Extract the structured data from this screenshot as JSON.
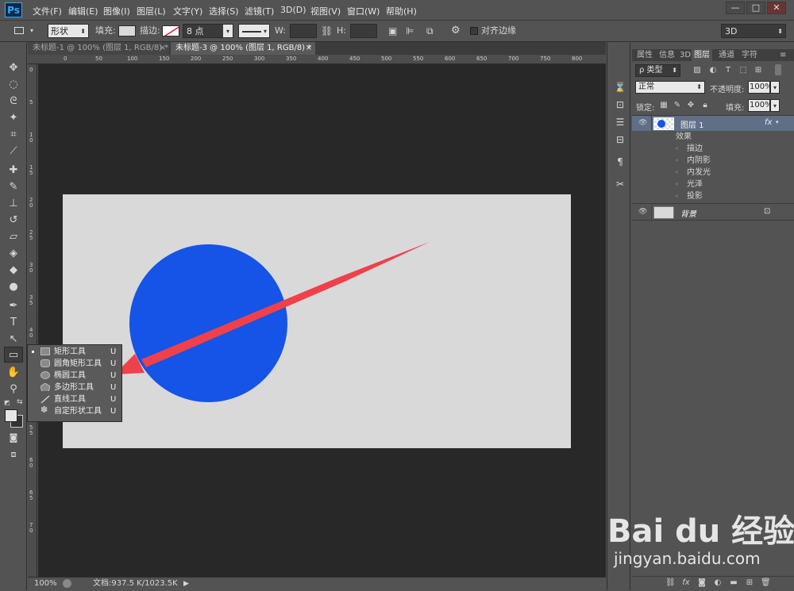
{
  "app": {
    "logo": "Ps"
  },
  "menu": [
    "文件(F)",
    "编辑(E)",
    "图像(I)",
    "图层(L)",
    "文字(Y)",
    "选择(S)",
    "滤镜(T)",
    "3D(D)",
    "视图(V)",
    "窗口(W)",
    "帮助(H)"
  ],
  "window_controls": {
    "minimize": "—",
    "restore": "□",
    "close": "✕"
  },
  "options": {
    "mode": "形状",
    "fill_label": "填充:",
    "stroke_label": "描边:",
    "stroke_size": "8 点",
    "w_label": "W:",
    "h_label": "H:",
    "align_edges": "对齐边缘",
    "workspace": "3D"
  },
  "tabs": [
    {
      "label": "未标题-1 @ 100% (图层 1, RGB/8) *",
      "close": "×"
    },
    {
      "label": "未标题-3 @ 100% (图层 1, RGB/8) *",
      "close": "×"
    }
  ],
  "ruler_h": [
    "0",
    "50",
    "100",
    "150",
    "200",
    "250",
    "300",
    "350",
    "400",
    "450",
    "500",
    "550",
    "600",
    "650",
    "700",
    "750",
    "800"
  ],
  "ruler_v": [
    "0",
    "5",
    "1 0",
    "1 5",
    "2 0",
    "2 5",
    "3 0",
    "3 5",
    "4 0",
    "4 5",
    "5 0",
    "5 5",
    "6 0",
    "6 5",
    "7 0"
  ],
  "flyout": [
    {
      "label": "矩形工具",
      "key": "U",
      "icon": "rect-icon",
      "active": true
    },
    {
      "label": "圆角矩形工具",
      "key": "U",
      "icon": "rounded-rect-icon",
      "active": false
    },
    {
      "label": "椭圆工具",
      "key": "U",
      "icon": "ellipse-icon",
      "active": false
    },
    {
      "label": "多边形工具",
      "key": "U",
      "icon": "polygon-icon",
      "active": false
    },
    {
      "label": "直线工具",
      "key": "U",
      "icon": "line-icon",
      "active": false
    },
    {
      "label": "自定形状工具",
      "key": "U",
      "icon": "custom-shape-icon",
      "active": false
    }
  ],
  "status": {
    "zoom": "100%",
    "doc": "文档:937.5 K/1023.5K"
  },
  "panel": {
    "tabs": [
      "属性",
      "信息",
      "3D",
      "图层",
      "通道",
      "字符"
    ],
    "active_tab": "图层",
    "filter": "ρ 类型",
    "blend_mode": "正常",
    "opacity_label": "不透明度:",
    "opacity": "100%",
    "lock_label": "锁定:",
    "fill_label": "填充:",
    "fill": "100%",
    "layers": [
      {
        "name": "图层 1",
        "fx": "fx"
      },
      {
        "name": "背景"
      }
    ],
    "effects_label": "效果",
    "effects": [
      "描边",
      "内阴影",
      "内发光",
      "光泽",
      "投影"
    ]
  },
  "watermark": {
    "logo": "Bai du 经验",
    "url": "jingyan.baidu.com"
  },
  "colors": {
    "circle": "#1554e6",
    "arrow": "#f0404a",
    "canvas": "#d9d9d9"
  }
}
